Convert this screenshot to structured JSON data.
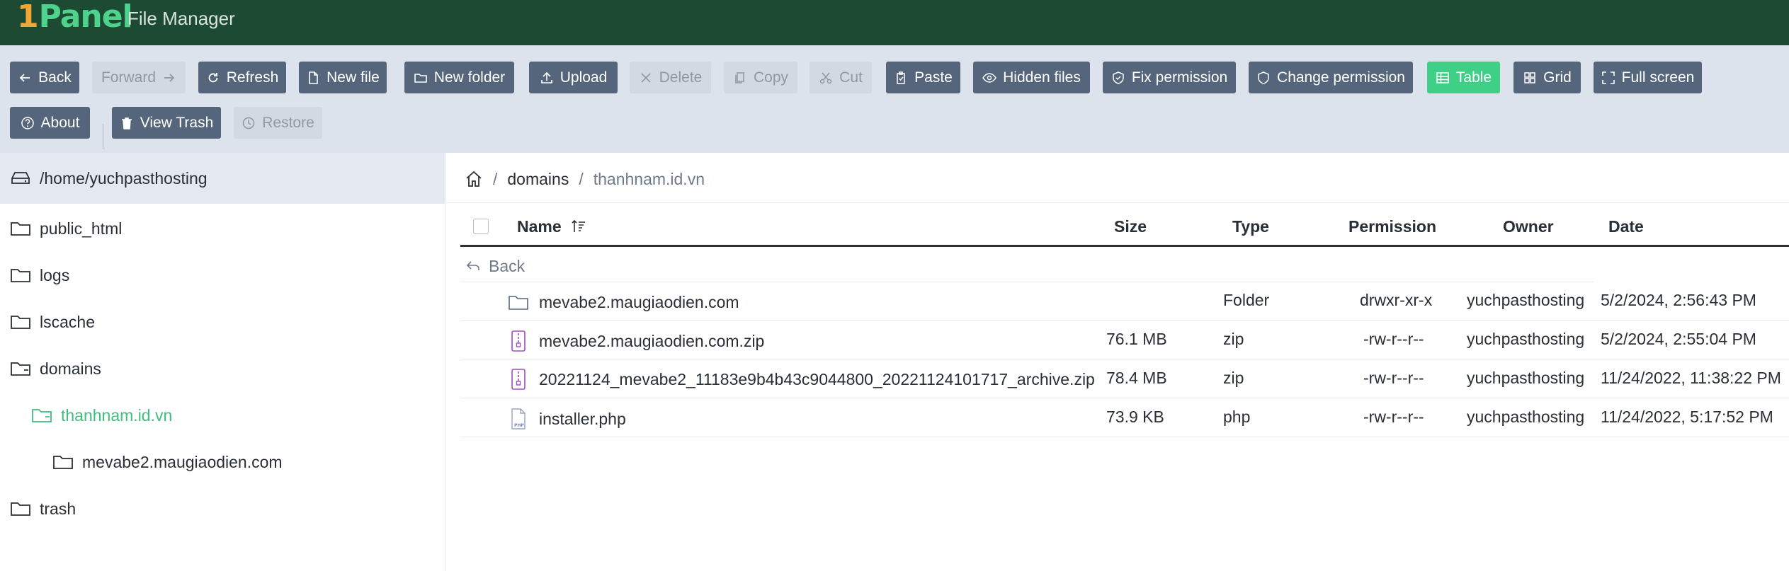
{
  "app": {
    "logo_one": "1",
    "logo_text": "Panel",
    "title": "File Manager"
  },
  "toolbar": {
    "back": "Back",
    "forward": "Forward",
    "refresh": "Refresh",
    "new_file": "New file",
    "new_folder": "New folder",
    "upload": "Upload",
    "delete": "Delete",
    "copy": "Copy",
    "cut": "Cut",
    "paste": "Paste",
    "hidden_files": "Hidden files",
    "fix_permission": "Fix permission",
    "change_permission": "Change permission",
    "table": "Table",
    "grid": "Grid",
    "full_screen": "Full screen",
    "about": "About",
    "view_trash": "View Trash",
    "restore": "Restore"
  },
  "tree": {
    "root": "/home/yuchpasthosting",
    "items": [
      {
        "label": "public_html"
      },
      {
        "label": "logs"
      },
      {
        "label": "lscache"
      },
      {
        "label": "domains"
      },
      {
        "label": "thanhnam.id.vn"
      },
      {
        "label": "mevabe2.maugiaodien.com"
      },
      {
        "label": "trash"
      }
    ]
  },
  "breadcrumb": {
    "separator": "/",
    "items": [
      "domains",
      "thanhnam.id.vn"
    ]
  },
  "table": {
    "columns": {
      "name": "Name",
      "size": "Size",
      "type": "Type",
      "permission": "Permission",
      "owner": "Owner",
      "date": "Date"
    },
    "back_label": "Back",
    "rows": [
      {
        "name": "mevabe2.maugiaodien.com",
        "size": "",
        "type": "Folder",
        "permission": "drwxr-xr-x",
        "owner": "yuchpasthosting",
        "date": "5/2/2024, 2:56:43 PM",
        "icon": "folder-icon"
      },
      {
        "name": "mevabe2.maugiaodien.com.zip",
        "size": "76.1 MB",
        "type": "zip",
        "permission": "-rw-r--r--",
        "owner": "yuchpasthosting",
        "date": "5/2/2024, 2:55:04 PM",
        "icon": "zip-icon"
      },
      {
        "name": "20221124_mevabe2_11183e9b4b43c9044800_20221124101717_archive.zip",
        "size": "78.4 MB",
        "type": "zip",
        "permission": "-rw-r--r--",
        "owner": "yuchpasthosting",
        "date": "11/24/2022, 11:38:22 PM",
        "icon": "zip-icon"
      },
      {
        "name": "installer.php",
        "size": "73.9 KB",
        "type": "php",
        "permission": "-rw-r--r--",
        "owner": "yuchpasthosting",
        "date": "11/24/2022, 5:17:52 PM",
        "icon": "php-icon"
      }
    ]
  },
  "colors": {
    "header_bg": "#1d4a33",
    "brand_green": "#4ed38c",
    "brand_orange": "#f1a732",
    "button_bg": "#55667c",
    "active_button": "#3fcf87",
    "toolbar_bg": "#dde3ec"
  }
}
